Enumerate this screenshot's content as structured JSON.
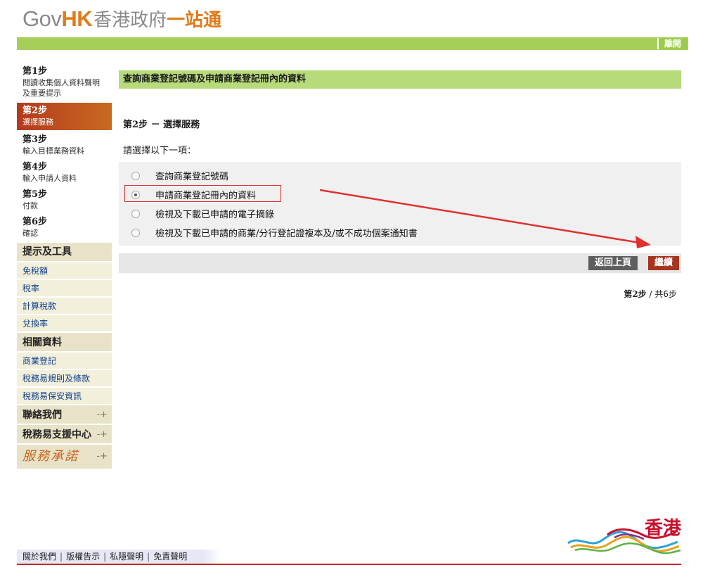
{
  "header": {
    "logo_gov": "Gov",
    "logo_hk": "HK",
    "logo_zh1": "香港政府",
    "logo_zh2": "一站通",
    "exit_label": "離開"
  },
  "sidebar": {
    "steps": [
      {
        "num": "第1步",
        "desc": "閱讀收集個人資料聲明及重要提示"
      },
      {
        "num": "第2步",
        "desc": "選擇服務"
      },
      {
        "num": "第3步",
        "desc": "輸入目標業務資料"
      },
      {
        "num": "第4步",
        "desc": "輸入申請人資料"
      },
      {
        "num": "第5步",
        "desc": "付款"
      },
      {
        "num": "第6步",
        "desc": "確認"
      }
    ],
    "tools_title": "提示及工具",
    "tools": [
      "免稅額",
      "稅率",
      "計算稅款",
      "兌換率"
    ],
    "related_title": "相關資料",
    "related": [
      "商業登記",
      "稅務易規則及條款",
      "稅務易保安資訊"
    ],
    "contact_label": "聯絡我們",
    "support_label": "稅務易支援中心",
    "promise_label": "服務承諾",
    "plus_symbol": "-+"
  },
  "main": {
    "title": "查詢商業登記號碼及申請商業登記冊內的資料",
    "step_title": "第2步 － 選擇服務",
    "prompt": "請選擇以下一項：",
    "options": [
      {
        "label": "查詢商業登記號碼",
        "checked": false
      },
      {
        "label": "申請商業登記冊內的資料",
        "checked": true
      },
      {
        "label": "檢視及下載已申請的電子摘錄",
        "checked": false
      },
      {
        "label": "檢視及下載已申請的商業/分行登記證複本及/或不成功個案通知書",
        "checked": false
      }
    ],
    "back_label": "返回上頁",
    "next_label": "繼續",
    "progress_step": "第2步",
    "progress_total": " / 共6步"
  },
  "footer": {
    "links": [
      "關於我們",
      "版權告示",
      "私隱聲明",
      "免責聲明"
    ],
    "brand_zh": "香港"
  },
  "colors": {
    "green_bar": "#a6cf5a",
    "active_step": "#b43a1c",
    "next_button": "#a6341e",
    "annotation_red": "#e03030"
  }
}
